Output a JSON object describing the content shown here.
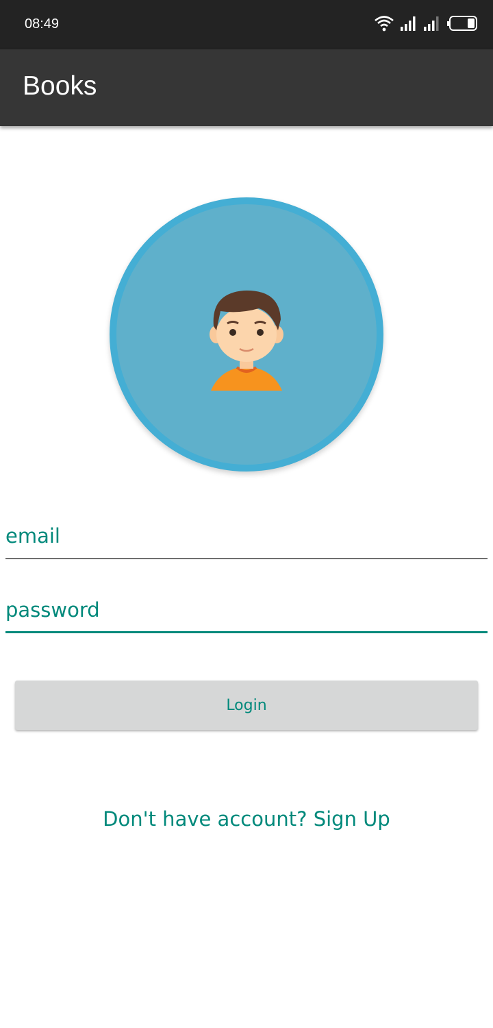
{
  "status_bar": {
    "time": "08:49",
    "icons": [
      "wifi-icon",
      "signal-icon",
      "signal-icon",
      "battery-icon"
    ]
  },
  "app_bar": {
    "title": "Books"
  },
  "avatar": {
    "icon": "user-avatar-icon",
    "ring_color": "#44aed4",
    "fill_color": "#5fb0cb"
  },
  "form": {
    "email_placeholder": "email",
    "password_placeholder": "password",
    "login_label": "Login",
    "signup_text": "Don't have account? Sign Up"
  },
  "colors": {
    "accent": "#00897b",
    "status_bar": "#232323",
    "app_bar": "#363636",
    "button": "#d6d7d7"
  }
}
